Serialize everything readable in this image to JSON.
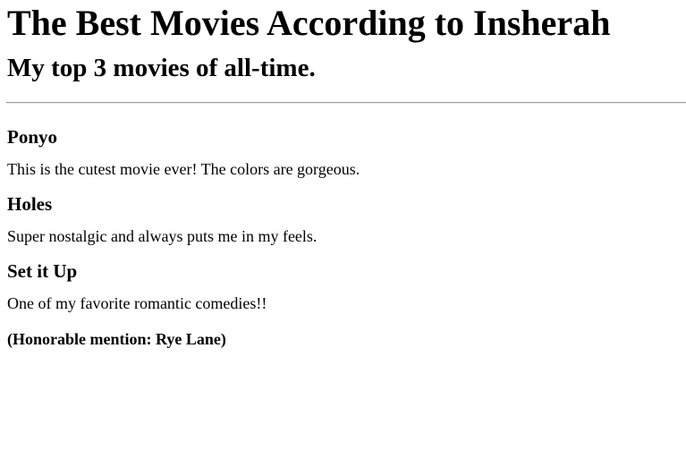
{
  "header": {
    "title": "The Best Movies According to Insherah",
    "subtitle": "My top 3 movies of all-time."
  },
  "movies": [
    {
      "title": "Ponyo",
      "description": "This is the cutest movie ever! The colors are gorgeous."
    },
    {
      "title": "Holes",
      "description": "Super nostalgic and always puts me in my feels."
    },
    {
      "title": "Set it Up",
      "description": "One of my favorite romantic comedies!!"
    }
  ],
  "honorable_mention": "(Honorable mention: Rye Lane)"
}
